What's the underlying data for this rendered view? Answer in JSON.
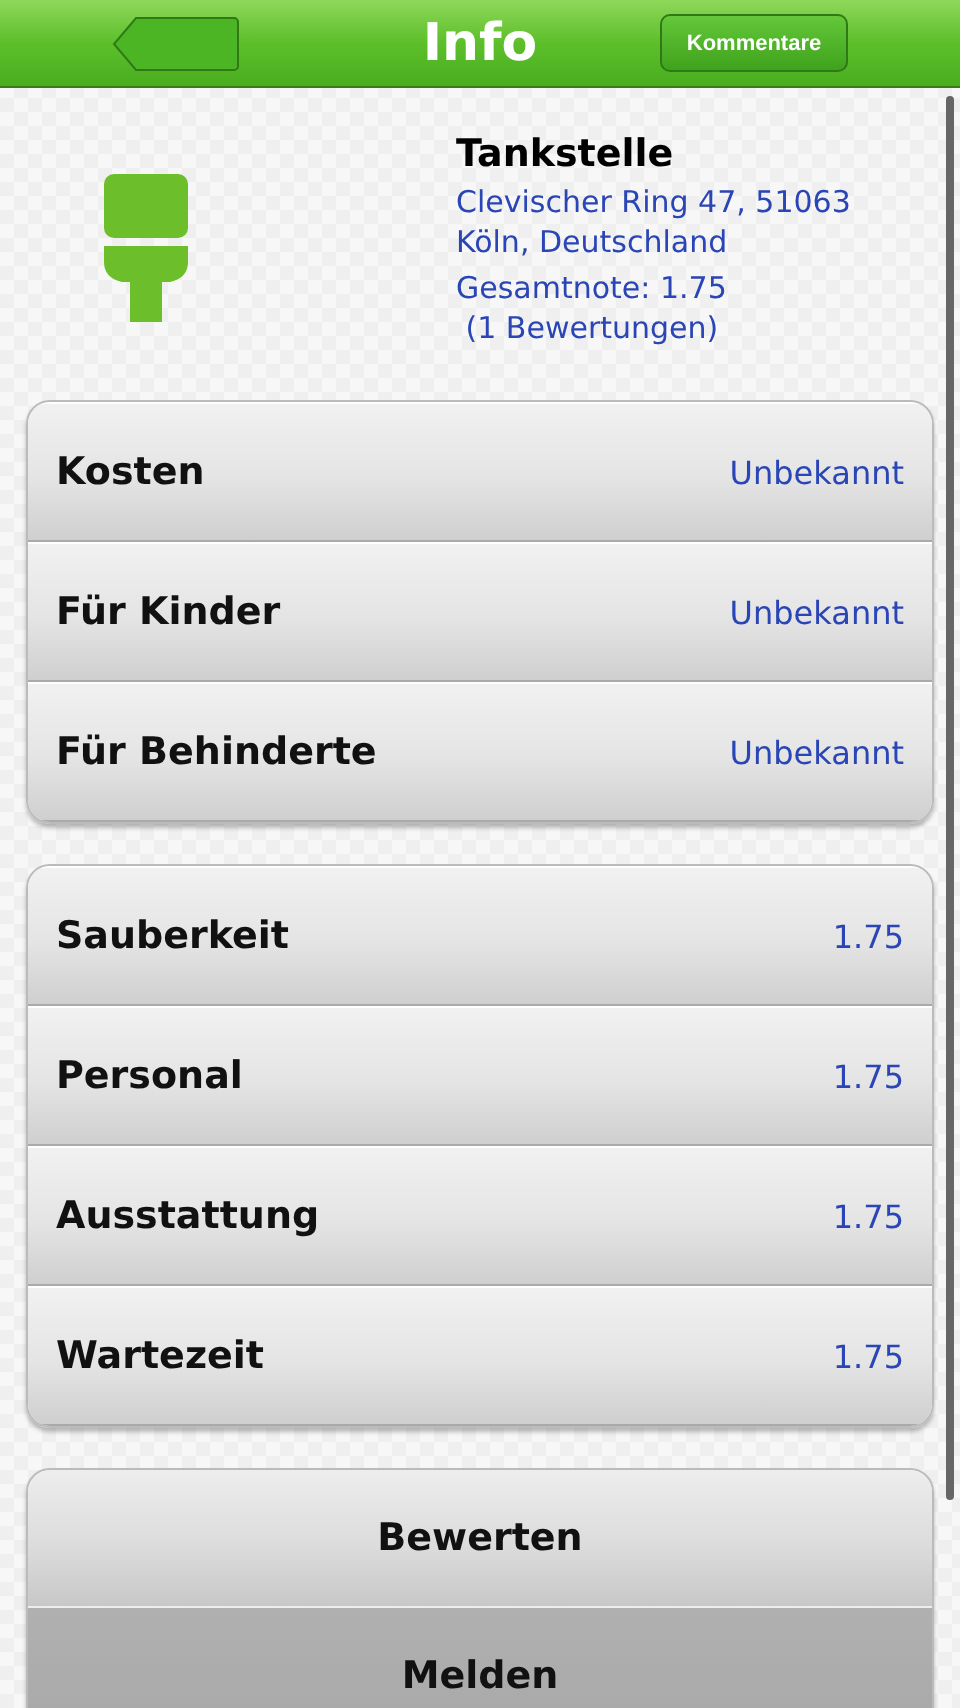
{
  "header": {
    "title": "Info",
    "right_button": "Kommentare"
  },
  "place": {
    "name": "Tankstelle",
    "address_lines": [
      "Clevischer Ring 47, 51063",
      "Köln, Deutschland"
    ],
    "rating": "Gesamtnote: 1.75",
    "count": " (1 Bewertungen)"
  },
  "groups": [
    {
      "rows": [
        {
          "label": "Kosten",
          "value": "Unbekannt"
        },
        {
          "label": "Für Kinder",
          "value": "Unbekannt"
        },
        {
          "label": "Für Behinderte",
          "value": "Unbekannt"
        }
      ]
    },
    {
      "rows": [
        {
          "label": "Sauberkeit",
          "value": "1.75"
        },
        {
          "label": "Personal",
          "value": "1.75"
        },
        {
          "label": "Ausstattung",
          "value": "1.75"
        },
        {
          "label": "Wartezeit",
          "value": "1.75"
        }
      ]
    }
  ],
  "actions": [
    {
      "label": "Bewerten",
      "pressed": false
    },
    {
      "label": "Melden",
      "pressed": true
    }
  ]
}
